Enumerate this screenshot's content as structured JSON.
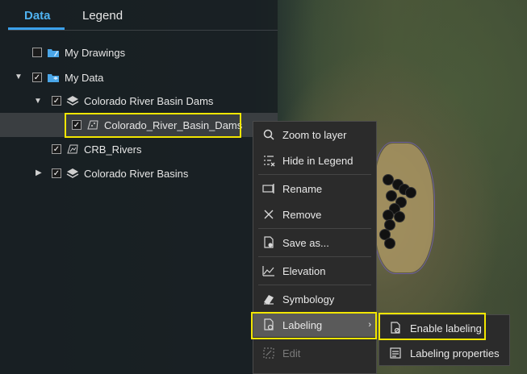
{
  "tabs": {
    "data": "Data",
    "legend": "Legend"
  },
  "tree": {
    "my_drawings": "My Drawings",
    "my_data": "My Data",
    "crb_dams_group": "Colorado River Basin Dams",
    "crb_dams_layer": "Colorado_River_Basin_Dams",
    "crb_rivers": "CRB_Rivers",
    "crb_basins": "Colorado River Basins"
  },
  "context_menu": {
    "zoom": "Zoom to layer",
    "hide": "Hide in Legend",
    "rename": "Rename",
    "remove": "Remove",
    "save_as": "Save as...",
    "elevation": "Elevation",
    "symbology": "Symbology",
    "labeling": "Labeling",
    "edit": "Edit"
  },
  "submenu": {
    "enable": "Enable labeling",
    "properties": "Labeling properties"
  },
  "colors": {
    "accent": "#3ba0ea",
    "highlight": "#f2e600"
  }
}
